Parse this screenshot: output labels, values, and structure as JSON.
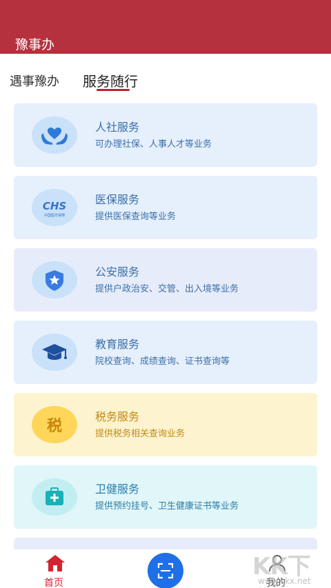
{
  "header": {
    "title": "豫事办",
    "bg_color": "#b5313d"
  },
  "tabs": [
    {
      "label": "遇事豫办",
      "active": false
    },
    {
      "label": "服务随行",
      "active": true
    }
  ],
  "cards": [
    {
      "title": "人社服务",
      "desc": "可办理社保、人事人才等业务",
      "icon": "hands-heart-icon",
      "theme": "blue"
    },
    {
      "title": "医保服务",
      "desc": "提供医保查询等业务",
      "icon": "chs-logo-icon",
      "icon_text": "CHS",
      "icon_subtext": "中国医疗保障",
      "theme": "blue"
    },
    {
      "title": "公安服务",
      "desc": "提供户政治安、交管、出入境等业务",
      "icon": "police-shield-icon",
      "theme": "blue"
    },
    {
      "title": "教育服务",
      "desc": "院校查询、成绩查询、证书查询等",
      "icon": "graduation-cap-icon",
      "theme": "blue"
    },
    {
      "title": "税务服务",
      "desc": "提供税务相关查询业务",
      "icon": "tax-icon",
      "icon_text": "税",
      "theme": "yellow"
    },
    {
      "title": "卫健服务",
      "desc": "提供预约挂号、卫生健康证书等业务",
      "icon": "medical-kit-icon",
      "theme": "teal"
    }
  ],
  "bottom_nav": {
    "home_label": "首页",
    "scan": "scan-icon",
    "mine_label": "我的"
  },
  "watermark": {
    "logo": "KK下载",
    "url": "www.kkx.net"
  },
  "colors": {
    "accent": "#c0202d",
    "scan_button": "#1f6fe6",
    "blue_card": "#e8f1fd",
    "yellow_card": "#fdf3cf",
    "teal_card": "#e1f6f8"
  }
}
